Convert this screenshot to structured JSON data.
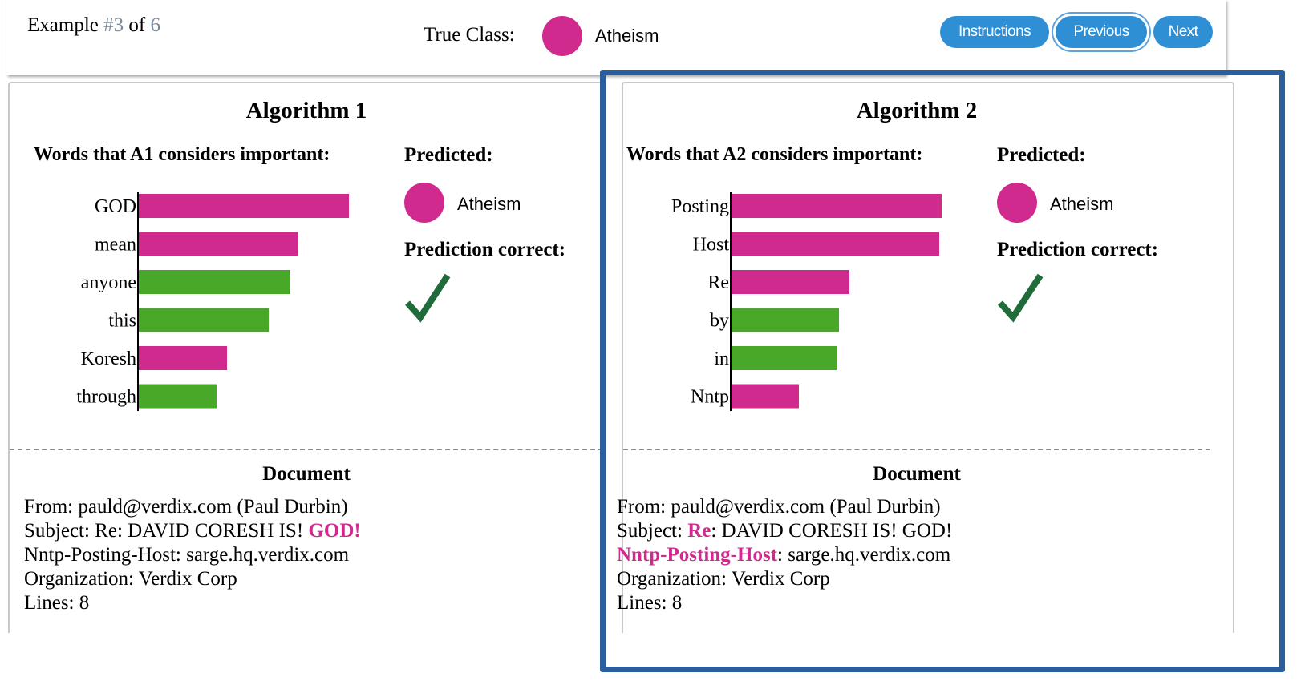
{
  "header": {
    "example_prefix": "Example ",
    "example_current": "#3",
    "example_of": " of ",
    "example_total": "6",
    "true_class_label": "True Class:",
    "true_class_value": "Atheism",
    "class_color": "#d12a8f",
    "buttons": {
      "instructions": "Instructions",
      "previous": "Previous",
      "next": "Next"
    }
  },
  "colors": {
    "positive": "#d12a8f",
    "negative": "#4aa829",
    "check": "#1f6b3a",
    "frame": "#2b5e9c"
  },
  "algorithms": [
    {
      "title": "Algorithm 1",
      "words_heading": "Words that A1 considers important:",
      "predicted_heading": "Predicted:",
      "predicted_value": "Atheism",
      "correct_heading": "Prediction correct:",
      "correct": true,
      "words": [
        {
          "word": "GOD",
          "weight": 1.0,
          "class": "positive"
        },
        {
          "word": "mean",
          "weight": 0.76,
          "class": "positive"
        },
        {
          "word": "anyone",
          "weight": 0.72,
          "class": "negative"
        },
        {
          "word": "this",
          "weight": 0.62,
          "class": "negative"
        },
        {
          "word": "Koresh",
          "weight": 0.42,
          "class": "positive"
        },
        {
          "word": "through",
          "weight": 0.37,
          "class": "negative"
        }
      ],
      "document_heading": "Document",
      "document": {
        "line1": "From: pauld@verdix.com (Paul Durbin)",
        "line2_pre": "Subject: Re: DAVID CORESH IS! ",
        "line2_hl": "GOD",
        "line2_post": "!",
        "line3": "Nntp-Posting-Host: sarge.hq.verdix.com",
        "line4": "Organization: Verdix Corp",
        "line5": "Lines: 8"
      }
    },
    {
      "title": "Algorithm 2",
      "words_heading": "Words that A2 considers important:",
      "predicted_heading": "Predicted:",
      "predicted_value": "Atheism",
      "correct_heading": "Prediction correct:",
      "correct": true,
      "words": [
        {
          "word": "Posting",
          "weight": 1.0,
          "class": "positive"
        },
        {
          "word": "Host",
          "weight": 0.99,
          "class": "positive"
        },
        {
          "word": "Re",
          "weight": 0.56,
          "class": "positive"
        },
        {
          "word": "by",
          "weight": 0.51,
          "class": "negative"
        },
        {
          "word": "in",
          "weight": 0.5,
          "class": "negative"
        },
        {
          "word": "Nntp",
          "weight": 0.32,
          "class": "positive"
        }
      ],
      "document_heading": "Document",
      "document": {
        "line1": "From: pauld@verdix.com (Paul Durbin)",
        "line2_pre": "Subject: ",
        "line2_hl": "Re",
        "line2_post": ": DAVID CORESH IS! GOD!",
        "line3_hl": "Nntp-Posting-Host",
        "line3_post": ": sarge.hq.verdix.com",
        "line4": "Organization: Verdix Corp",
        "line5": "Lines: 8"
      }
    }
  ]
}
